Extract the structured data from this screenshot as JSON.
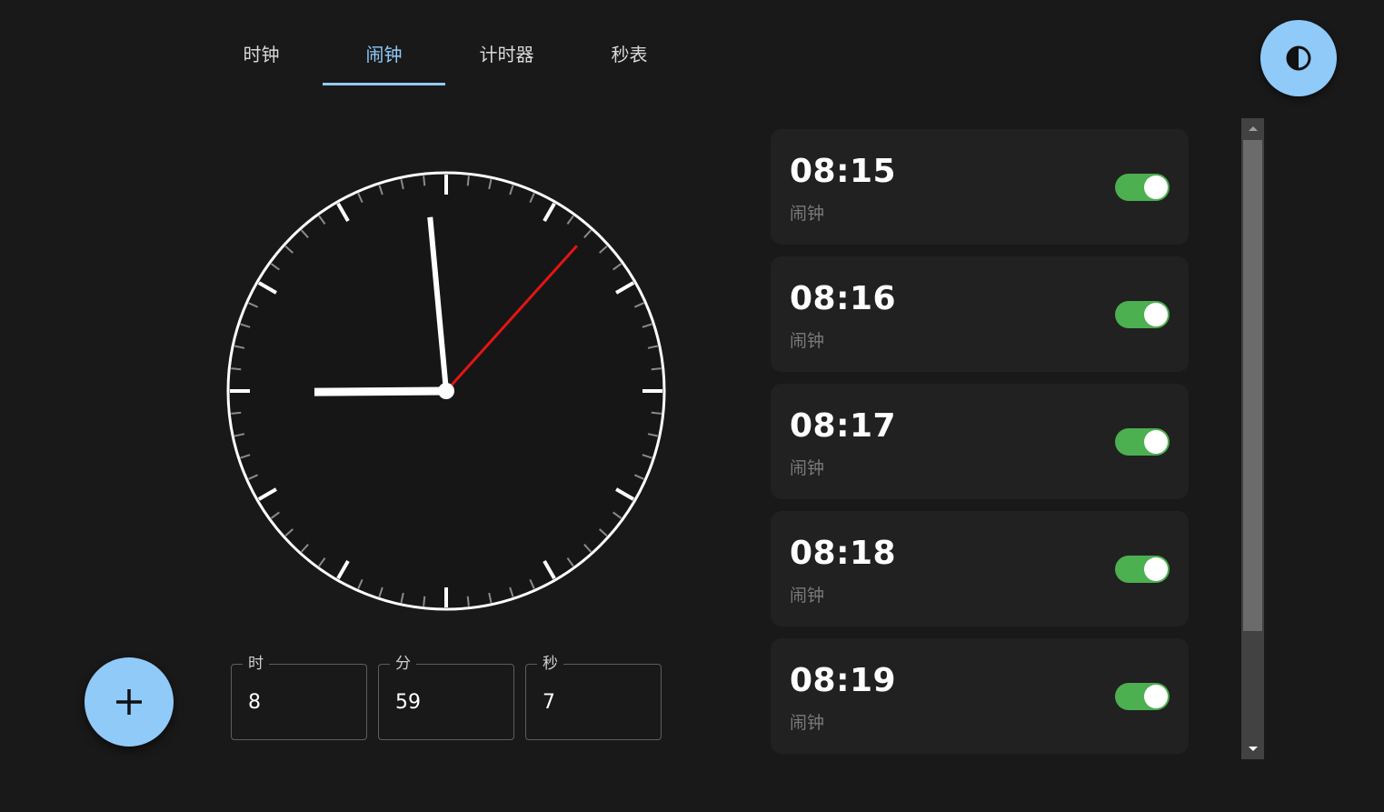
{
  "tabs": [
    {
      "label": "时钟",
      "active": false
    },
    {
      "label": "闹钟",
      "active": true
    },
    {
      "label": "计时器",
      "active": false
    },
    {
      "label": "秒表",
      "active": false
    }
  ],
  "theme_toggle": {
    "icon": "contrast-icon"
  },
  "clock": {
    "icon": "analog-clock",
    "hour": 8,
    "minute": 59,
    "second": 7,
    "second_hand_color": "#e41414",
    "hand_color": "#ffffff"
  },
  "add_button": {
    "icon": "plus-icon"
  },
  "time_fields": [
    {
      "label": "时",
      "value": "8"
    },
    {
      "label": "分",
      "value": "59"
    },
    {
      "label": "秒",
      "value": "7"
    }
  ],
  "alarms": [
    {
      "time": "08:15",
      "label": "闹钟",
      "enabled": true
    },
    {
      "time": "08:16",
      "label": "闹钟",
      "enabled": true
    },
    {
      "time": "08:17",
      "label": "闹钟",
      "enabled": true
    },
    {
      "time": "08:18",
      "label": "闹钟",
      "enabled": true
    },
    {
      "time": "08:19",
      "label": "闹钟",
      "enabled": true
    }
  ],
  "colors": {
    "accent": "#90caf9",
    "toggle_on": "#4caf50",
    "background": "#191919",
    "card": "#212121"
  }
}
